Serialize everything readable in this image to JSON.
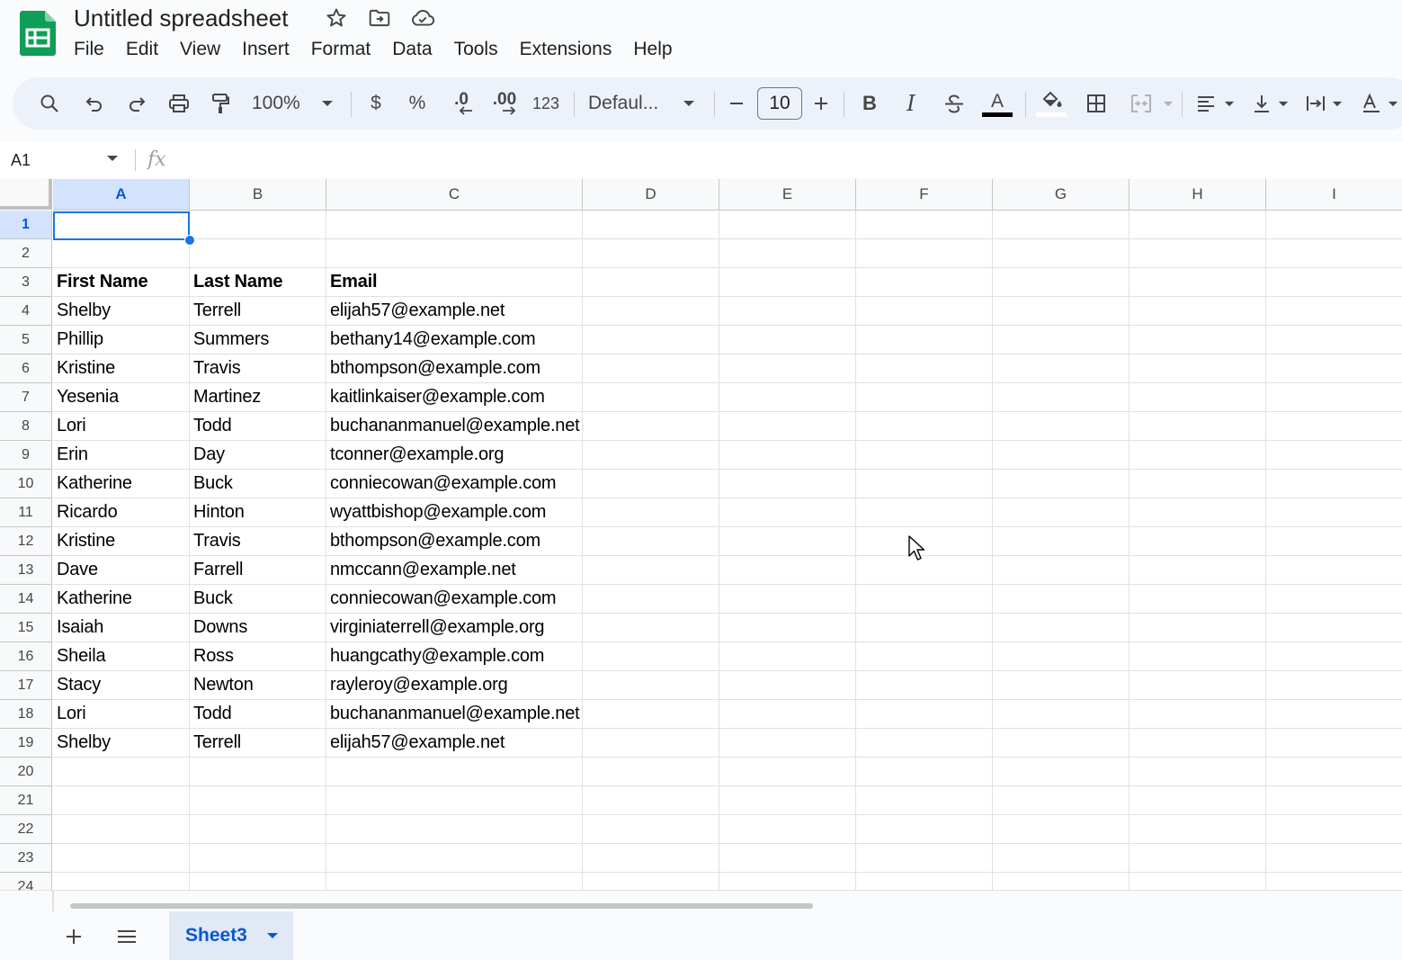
{
  "header": {
    "title": "Untitled spreadsheet",
    "menu": [
      "File",
      "Edit",
      "View",
      "Insert",
      "Format",
      "Data",
      "Tools",
      "Extensions",
      "Help"
    ]
  },
  "toolbar": {
    "zoom": "100%",
    "currency": "$",
    "percent": "%",
    "decrease_decimal": ".0",
    "increase_decimal": ".00",
    "number_format": "123",
    "font": "Defaul...",
    "font_size": "10",
    "bold": "B",
    "italic": "I",
    "text_color_letter": "A"
  },
  "formula_bar": {
    "cell_ref": "A1",
    "fx": "fx",
    "value": ""
  },
  "grid": {
    "columns": [
      "A",
      "B",
      "C",
      "D",
      "E",
      "F",
      "G",
      "H",
      "I"
    ],
    "rows": [
      "1",
      "2",
      "3",
      "4",
      "5",
      "6",
      "7",
      "8",
      "9",
      "10",
      "11",
      "12",
      "13",
      "14",
      "15",
      "16",
      "17",
      "18",
      "19",
      "20",
      "21",
      "22",
      "23",
      "24"
    ],
    "selected_cell": "A1",
    "headers": [
      "First Name",
      "Last Name",
      "Email"
    ],
    "data": [
      [
        "Shelby",
        "Terrell",
        "elijah57@example.net"
      ],
      [
        "Phillip",
        "Summers",
        "bethany14@example.com"
      ],
      [
        "Kristine",
        "Travis",
        "bthompson@example.com"
      ],
      [
        "Yesenia",
        "Martinez",
        "kaitlinkaiser@example.com"
      ],
      [
        "Lori",
        "Todd",
        "buchananmanuel@example.net"
      ],
      [
        "Erin",
        "Day",
        "tconner@example.org"
      ],
      [
        "Katherine",
        "Buck",
        "conniecowan@example.com"
      ],
      [
        "Ricardo",
        "Hinton",
        "wyattbishop@example.com"
      ],
      [
        "Kristine",
        "Travis",
        "bthompson@example.com"
      ],
      [
        "Dave",
        "Farrell",
        "nmccann@example.net"
      ],
      [
        "Katherine",
        "Buck",
        "conniecowan@example.com"
      ],
      [
        "Isaiah",
        "Downs",
        "virginiaterrell@example.org"
      ],
      [
        "Sheila",
        "Ross",
        "huangcathy@example.com"
      ],
      [
        "Stacy",
        "Newton",
        "rayleroy@example.org"
      ],
      [
        "Lori",
        "Todd",
        "buchananmanuel@example.net"
      ],
      [
        "Shelby",
        "Terrell",
        "elijah57@example.net"
      ]
    ]
  },
  "sheets": {
    "active": "Sheet3"
  },
  "colors": {
    "accent": "#0b57d0",
    "selection": "#1a73e8",
    "logo_green": "#0f9d58"
  }
}
